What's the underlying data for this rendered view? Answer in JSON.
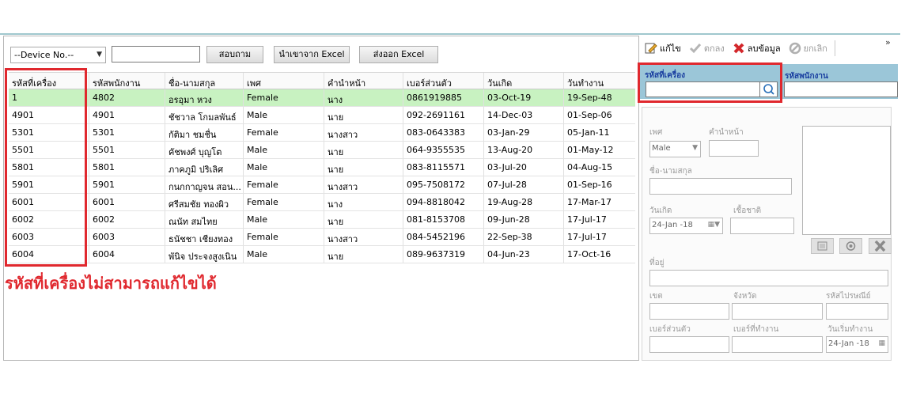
{
  "toolbar": {
    "device_select": "--Device No.--",
    "search_value": "",
    "query_button": "สอบถาม",
    "import_button": "นำเขาจาก Excel",
    "export_button": "ส่งออก Excel"
  },
  "grid": {
    "headers": [
      "รหัสที่เครื่อง",
      "รหัสพนักงาน",
      "ชื่อ-นามสกุล",
      "เพศ",
      "คำนำหน้า",
      "เบอร์ส่วนตัว",
      "วันเกิด",
      "วันทำงาน"
    ],
    "rows": [
      [
        "1",
        "4802",
        "อรอุมา หวง",
        "Female",
        "นาง",
        "0861919885",
        "03-Oct-19",
        "19-Sep-48"
      ],
      [
        "4901",
        "4901",
        "ชัชวาล โกมลพันธ์",
        "Male",
        "นาย",
        "092-2691161",
        "14-Dec-03",
        "01-Sep-06"
      ],
      [
        "5301",
        "5301",
        "กัติมา ชมชื่น",
        "Female",
        "นางสาว",
        "083-0643383",
        "03-Jan-29",
        "05-Jan-11"
      ],
      [
        "5501",
        "5501",
        "คัชพงศ์ บุญโต",
        "Male",
        "นาย",
        "064-9355535",
        "13-Aug-20",
        "01-May-12"
      ],
      [
        "5801",
        "5801",
        "ภาคภูมิ ปริเลิศ",
        "Male",
        "นาย",
        "083-8115571",
        "03-Jul-20",
        "04-Aug-15"
      ],
      [
        "5901",
        "5901",
        "กนกกาญจน สอน...",
        "Female",
        "นางสาว",
        "095-7508172",
        "07-Jul-28",
        "01-Sep-16"
      ],
      [
        "6001",
        "6001",
        "ศรีสมชัย ทองผิว",
        "Female",
        "นาง",
        "094-8818042",
        "19-Aug-28",
        "17-Mar-17"
      ],
      [
        "6002",
        "6002",
        "ณนัท สมไทย",
        "Male",
        "นาย",
        "081-8153708",
        "09-Jun-28",
        "17-Jul-17"
      ],
      [
        "6003",
        "6003",
        "ธนัชชา เชียงทอง",
        "Female",
        "นางสาว",
        "084-5452196",
        "22-Sep-38",
        "17-Jul-17"
      ],
      [
        "6004",
        "6004",
        "พันิจ ประจงสูงเนิน",
        "Male",
        "นาย",
        "089-9637319",
        "04-Jun-23",
        "17-Oct-16"
      ]
    ]
  },
  "note": "รหัสที่เครื่องไม่สามารถแก้ไขได้",
  "panel": {
    "edit": "แก้ไข",
    "ok": "ตกลง",
    "delete": "ลบข้อมูล",
    "cancel": "ยกเลิก",
    "more": "»",
    "device_code_label": "รหัสที่เครื่อง",
    "employee_code_label": "รหัสพนักงาน"
  },
  "form": {
    "gender_label": "เพศ",
    "gender_value": "Male",
    "prefix_label": "คำนำหน้า",
    "name_label": "ชื่อ-นามสกุล",
    "birth_label": "วันเกิด",
    "birth_value": "24-Jan -18",
    "nationality_label": "เชื้อชาติ",
    "address_label": "ที่อยู่",
    "district_label": "เขต",
    "province_label": "จังหวัด",
    "postal_label": "รหัสไปรษณีย์",
    "mobile_label": "เบอร์ส่วนตัว",
    "work_phone_label": "เบอร์ที่ทำงาน",
    "start_label": "วันเริ่มทำงาน",
    "start_value": "24-Jan -18"
  },
  "colors": {
    "highlight": "#e0282e",
    "selected_row": "#c8f2c1",
    "strip": "#9bc6d8"
  }
}
